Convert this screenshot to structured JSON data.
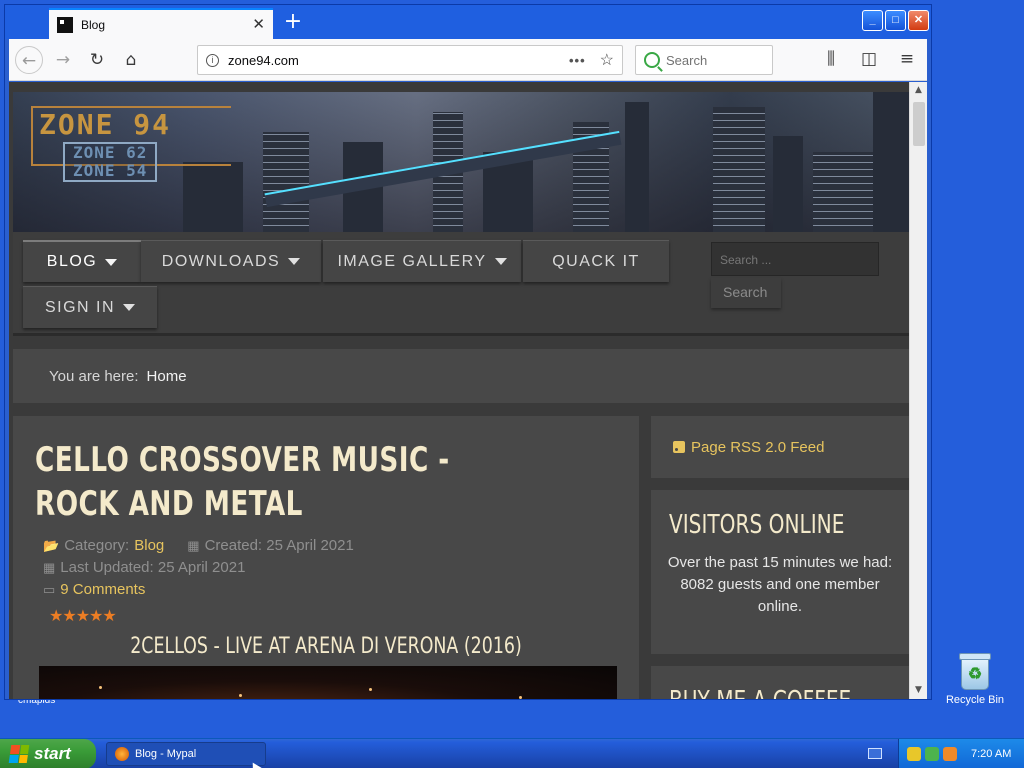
{
  "desktop": {
    "behind_label": "cmapids",
    "recycle_bin_label": "Recycle Bin"
  },
  "browser": {
    "tab_title": "Blog",
    "new_tab_glyph": "+",
    "url": "zone94.com",
    "search_placeholder": "Search",
    "window_buttons": [
      "_",
      "□",
      "✕"
    ],
    "icons": [
      "back-icon",
      "forward-icon",
      "reload-icon",
      "home-icon",
      "info-icon",
      "page-actions-icon",
      "bookmark-star-icon",
      "library-icon",
      "sidebar-icon",
      "hamburger-menu-icon"
    ]
  },
  "site": {
    "logo_main": "ZONE 94",
    "logo_sub1": "ZONE 62",
    "logo_sub2": "ZONE 54",
    "menu": [
      {
        "label": "BLOG",
        "has_caret": true,
        "active": true
      },
      {
        "label": "DOWNLOADS",
        "has_caret": true
      },
      {
        "label": "IMAGE GALLERY",
        "has_caret": true
      },
      {
        "label": "QUACK IT",
        "has_caret": false
      },
      {
        "label": "SIGN IN",
        "has_caret": true
      }
    ],
    "search_placeholder": "Search ...",
    "search_button": "Search",
    "breadcrumb": {
      "prefix": "You are here:",
      "current": "Home"
    }
  },
  "article": {
    "title": "CELLO CROSSOVER MUSIC - ROCK AND METAL",
    "category_label": "Category:",
    "category_value": "Blog",
    "created": "Created: 25 April 2021",
    "updated": "Last Updated: 25 April 2021",
    "comments": "9 Comments",
    "rating_stars": 5,
    "video_title": "2CELLOS - LIVE AT ARENA DI VERONA (2016)"
  },
  "sidebar": {
    "rss": "Page RSS 2.0 Feed",
    "visitors_title": "VISITORS ONLINE",
    "visitors_line1": "Over the past 15 minutes we had:",
    "visitors_line2": "8082 guests and one member online.",
    "coffee_title": "BUY ME A COFFEE"
  },
  "taskbar": {
    "start": "start",
    "task_label": "Blog - Mypal",
    "clock": "7:20 AM"
  },
  "colors": {
    "accent_gold": "#e7c45e",
    "title_cream": "#f4eacb",
    "star_orange": "#ec7d24",
    "xp_blue": "#245edb",
    "start_green": "#3a9c38"
  }
}
